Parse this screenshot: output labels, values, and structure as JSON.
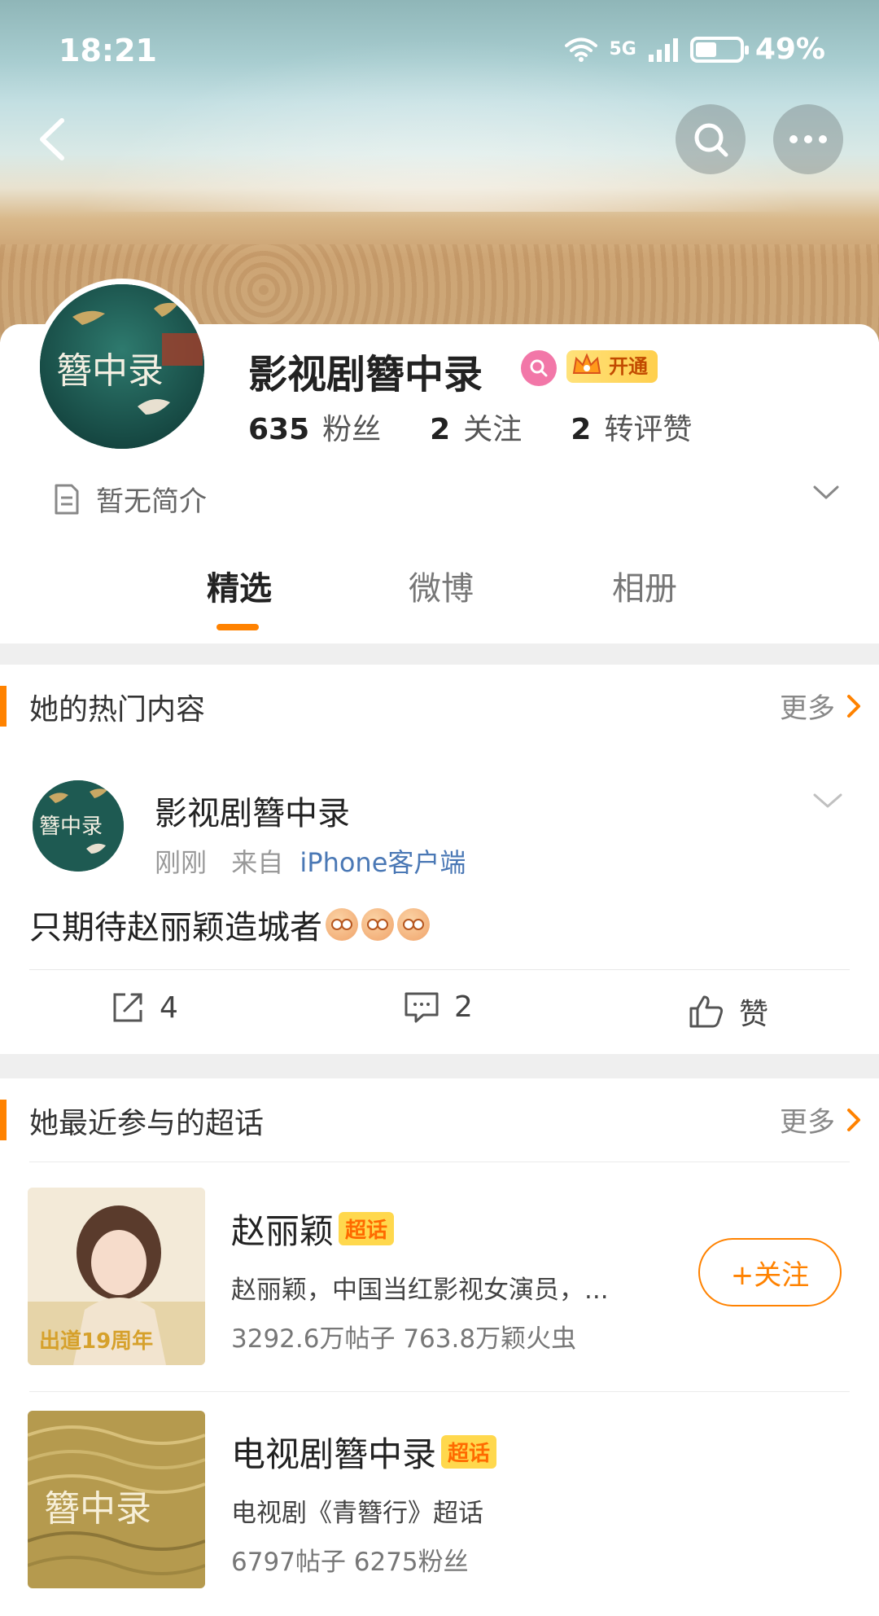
{
  "status_bar": {
    "time": "18:21",
    "network": "5G",
    "battery_percent": "49%",
    "battery_level": 0.49
  },
  "nav": {
    "back_icon": "back-arrow-icon",
    "search_icon": "search-icon",
    "more_icon": "more-dots-icon"
  },
  "profile": {
    "name": "影视剧簪中录",
    "avatar_text": "簪中录",
    "open_badge": "开通",
    "stats": [
      {
        "value": "635",
        "label": "粉丝"
      },
      {
        "value": "2",
        "label": "关注"
      },
      {
        "value": "2",
        "label": "转评赞"
      }
    ],
    "intro": "暂无简介"
  },
  "tabs": [
    {
      "label": "精选",
      "active": true
    },
    {
      "label": "微博",
      "active": false
    },
    {
      "label": "相册",
      "active": false
    }
  ],
  "hot_section": {
    "title": "她的热门内容",
    "more": "更多"
  },
  "post": {
    "author": "影视剧簪中录",
    "avatar_text": "簪中录",
    "time": "刚刚",
    "from_label": "来自",
    "source": "iPhone客户端",
    "text": "只期待赵丽颖造城者",
    "repost_count": "4",
    "comment_count": "2",
    "like_label": "赞"
  },
  "topics_section": {
    "title": "她最近参与的超话",
    "more": "更多"
  },
  "topics": [
    {
      "name": "赵丽颖",
      "badge": "超话",
      "desc": "赵丽颖，中国当红影视女演员，...",
      "stats": "3292.6万帖子 763.8万颖火虫",
      "image_caption": "出道19周年",
      "follow": "+关注"
    },
    {
      "name": "电视剧簪中录",
      "badge": "超话",
      "desc": "电视剧《青簪行》超话",
      "stats": "6797帖子 6275粉丝",
      "image_caption": "簪中录"
    }
  ],
  "colors": {
    "accent": "#ff8200",
    "link": "#4a78b5",
    "badge": "#ffd84d"
  }
}
